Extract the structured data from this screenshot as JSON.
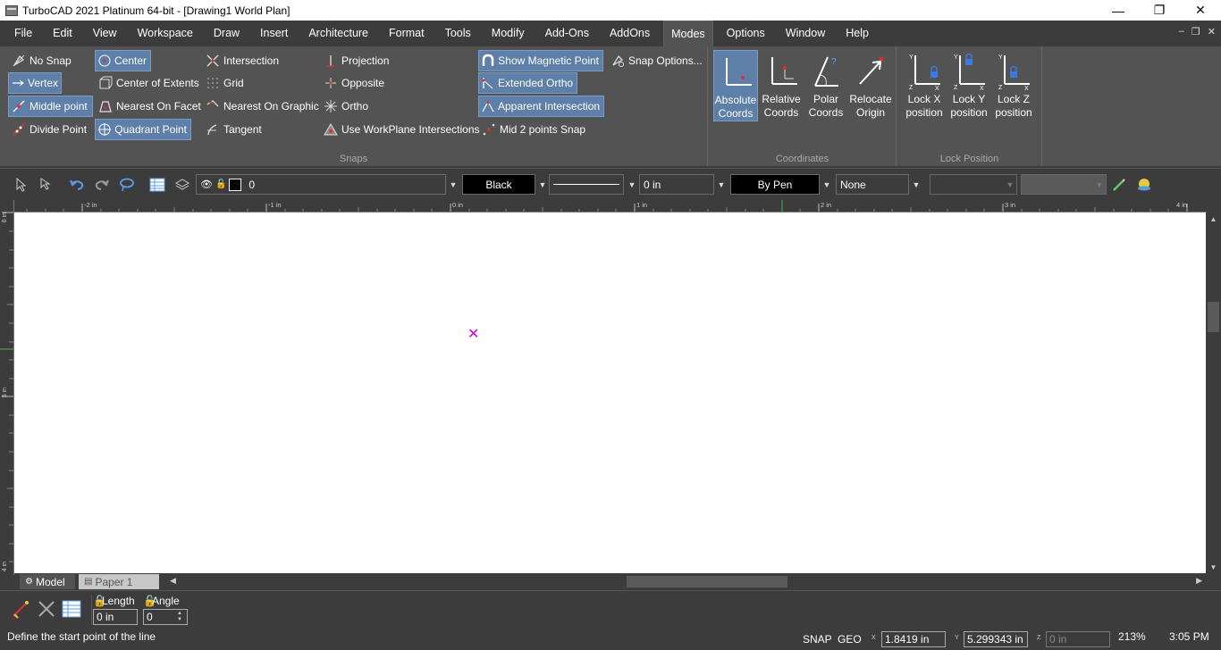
{
  "window": {
    "title": "TurboCAD 2021 Platinum 64-bit - [Drawing1 World Plan]",
    "minimize": "—",
    "restore": "❐",
    "close": "✕"
  },
  "menu": [
    "File",
    "Edit",
    "View",
    "Workspace",
    "Draw",
    "Insert",
    "Architecture",
    "Format",
    "Tools",
    "Modify",
    "Add-Ons",
    "AddOns",
    "Modes",
    "Options",
    "Window",
    "Help"
  ],
  "active_menu": "Modes",
  "mdi_controls": [
    "–",
    "❐",
    "✕"
  ],
  "snaps": {
    "panel_label": "Snaps",
    "no_snap": "No Snap",
    "vertex": "Vertex",
    "middle_point": "Middle point",
    "divide_point": "Divide Point",
    "center": "Center",
    "center_of_extents": "Center of Extents",
    "nearest_on_facet": "Nearest On Facet",
    "quadrant_point": "Quadrant Point",
    "intersection": "Intersection",
    "grid": "Grid",
    "nearest_on_graphic": "Nearest On Graphic",
    "tangent": "Tangent",
    "projection": "Projection",
    "opposite": "Opposite",
    "ortho": "Ortho",
    "use_workplane_intersections": "Use WorkPlane Intersections",
    "show_magnetic_point": "Show Magnetic Point",
    "extended_ortho": "Extended Ortho",
    "apparent_intersection": "Apparent Intersection",
    "mid_2_points_snap": "Mid 2 points Snap",
    "snap_options": "Snap Options..."
  },
  "coordinates": {
    "panel_label": "Coordinates",
    "absolute_1": "Absolute",
    "absolute_2": "Coords",
    "relative_1": "Relative",
    "relative_2": "Coords",
    "polar_1": "Polar",
    "polar_2": "Coords",
    "relocate_1": "Relocate",
    "relocate_2": "Origin"
  },
  "lock_position": {
    "panel_label": "Lock Position",
    "x_1": "Lock X",
    "x_2": "position",
    "y_1": "Lock Y",
    "y_2": "position",
    "z_1": "Lock Z",
    "z_2": "position"
  },
  "toolbar": {
    "layer_value": "0",
    "color_value": "Black",
    "thickness_value": "0 in",
    "pen_value": "By Pen",
    "none_value": "None"
  },
  "ruler": {
    "h_ticks": [
      "-2 in",
      "-1 in",
      "0 in",
      "1 in",
      "2 in",
      "3 in",
      "4 in"
    ],
    "v_ticks": [
      "6 in",
      "5 in",
      "4 in"
    ]
  },
  "tabs": {
    "model": "Model",
    "paper": "Paper 1"
  },
  "inputbar": {
    "length_label": "Length",
    "length_value": "0 in",
    "angle_label": "Angle",
    "angle_value": "0"
  },
  "status": {
    "prompt": "Define the start point of the line",
    "snap": "SNAP",
    "geo": "GEO",
    "x_label": "X",
    "x_value": "1.8419 in",
    "y_label": "Y",
    "y_value": "5.299343 in",
    "z_label": "Z",
    "z_value": "0 in",
    "zoom": "213%",
    "time": "3:05 PM"
  },
  "colors": {
    "accent_active": "#5d7fa8",
    "background": "#3c3c3c",
    "ribbon": "#535353",
    "cursor": "#d200d2"
  }
}
